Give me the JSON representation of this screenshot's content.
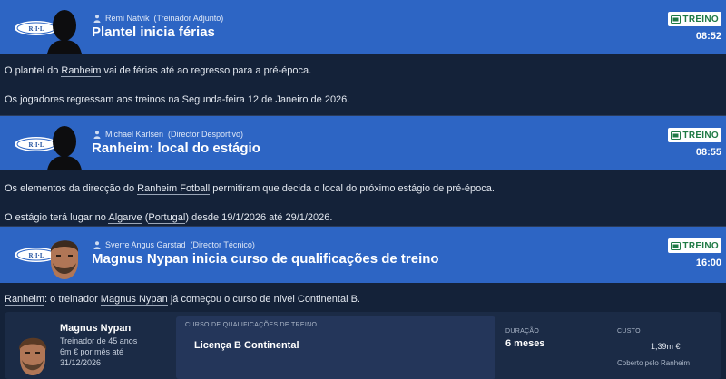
{
  "messages": [
    {
      "sender_name": "Remi Natvik",
      "sender_role": "(Treinador Adjunto)",
      "subject": "Plantel inicia férias",
      "tag": "TREINO",
      "time": "08:52"
    },
    {
      "sender_name": "Michael Karlsen",
      "sender_role": "(Director Desportivo)",
      "subject": "Ranheim: local do estágio",
      "tag": "TREINO",
      "time": "08:55"
    },
    {
      "sender_name": "Sverre Angus Garstad",
      "sender_role": "(Director Técnico)",
      "subject": "Magnus Nypan inicia curso de qualificações de treino",
      "tag": "TREINO",
      "time": "16:00"
    }
  ],
  "club_crest_text": "R·I·L",
  "body1": {
    "p1_pre": "O plantel do ",
    "p1_link": "Ranheim",
    "p1_post": " vai de férias até ao regresso para a pré-época.",
    "p2": "Os jogadores regressam aos treinos na Segunda-feira 12 de Janeiro de 2026."
  },
  "body2": {
    "p1_pre": "Os elementos da direcção do ",
    "p1_link": "Ranheim Fotball",
    "p1_post": " permitiram que decida o local do próximo estágio de pré-época.",
    "p2_pre": "O estágio terá lugar no ",
    "p2_link1": "Algarve",
    "p2_mid1": " (",
    "p2_link2": "Portugal",
    "p2_post": ") desde 19/1/2026 até 29/1/2026."
  },
  "body3": {
    "p1_link1": "Ranheim",
    "p1_mid": ": o treinador ",
    "p1_link2": "Magnus Nypan",
    "p1_post": " já começou o curso de nível Continental B."
  },
  "card": {
    "name": "Magnus Nypan",
    "role": "Treinador de 45 anos",
    "salary": "6m € por mês até",
    "contract_end": "31/12/2026",
    "course_header": "CURSO DE QUALIFICAÇÕES DE TREINO",
    "course_value": "Licença B Continental",
    "duration_header": "DURAÇÃO",
    "duration_value": "6 meses",
    "cost_header": "CUSTO",
    "cost_value": "1,39m €",
    "cost_note": "Coberto pelo Ranheim"
  },
  "colors": {
    "header_blue": "#2d65c4",
    "body_navy": "#142239",
    "tag_green": "#1f7a45"
  }
}
